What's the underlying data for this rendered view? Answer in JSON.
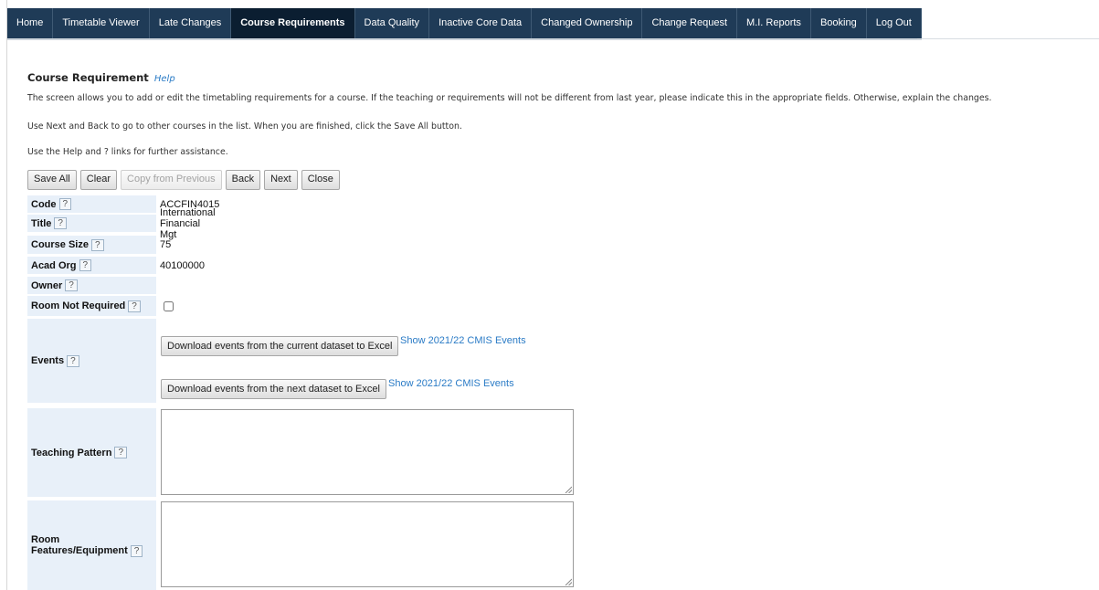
{
  "nav": {
    "items": [
      "Home",
      "Timetable Viewer",
      "Late Changes",
      "Course Requirements",
      "Data Quality",
      "Inactive Core Data",
      "Changed Ownership",
      "Change Request",
      "M.I. Reports",
      "Booking",
      "Log Out"
    ],
    "active_index": 3
  },
  "page": {
    "title": "Course Requirement",
    "help_link": "Help",
    "intro_1": "The screen allows you to add or edit the timetabling requirements for a course. If the teaching or requirements will not be different from last year, please indicate this in the appropriate fields. Otherwise, explain the changes.",
    "intro_2": "Use Next and Back to go to other courses in the list. When you are finished, click the Save All button.",
    "intro_3": "Use the Help and ? links for further assistance."
  },
  "toolbar": {
    "save_all": "Save All",
    "clear": "Clear",
    "copy_from_previous": "Copy from Previous",
    "back": "Back",
    "next": "Next",
    "close": "Close"
  },
  "form": {
    "help_marker": "?",
    "code_label": "Code",
    "code_value": "ACCFIN4015",
    "title_label": "Title",
    "title_value": "International Financial Mgt",
    "size_label": "Course Size",
    "size_value": "75",
    "acad_label": "Acad Org",
    "acad_value": "40100000",
    "owner_label": "Owner",
    "owner_value": "",
    "room_nr_label": "Room Not Required",
    "room_nr_checked": false,
    "events_label": "Events",
    "download_current": "Download events from the current dataset to Excel",
    "download_next": "Download events from the next dataset to Excel",
    "cmis_link_1": "Show 2021/22 CMIS Events",
    "cmis_link_2": "Show 2021/22 CMIS Events",
    "teaching_label": "Teaching Pattern",
    "teaching_value": "",
    "room_feat_label_1": "Room",
    "room_feat_label_2": "Features/Equipment",
    "room_feat_value": ""
  },
  "colors": {
    "nav_bg": "#1f3b57",
    "nav_active": "#0b1e31",
    "label_bg": "#e8f0f9",
    "link": "#2a7bc6"
  }
}
